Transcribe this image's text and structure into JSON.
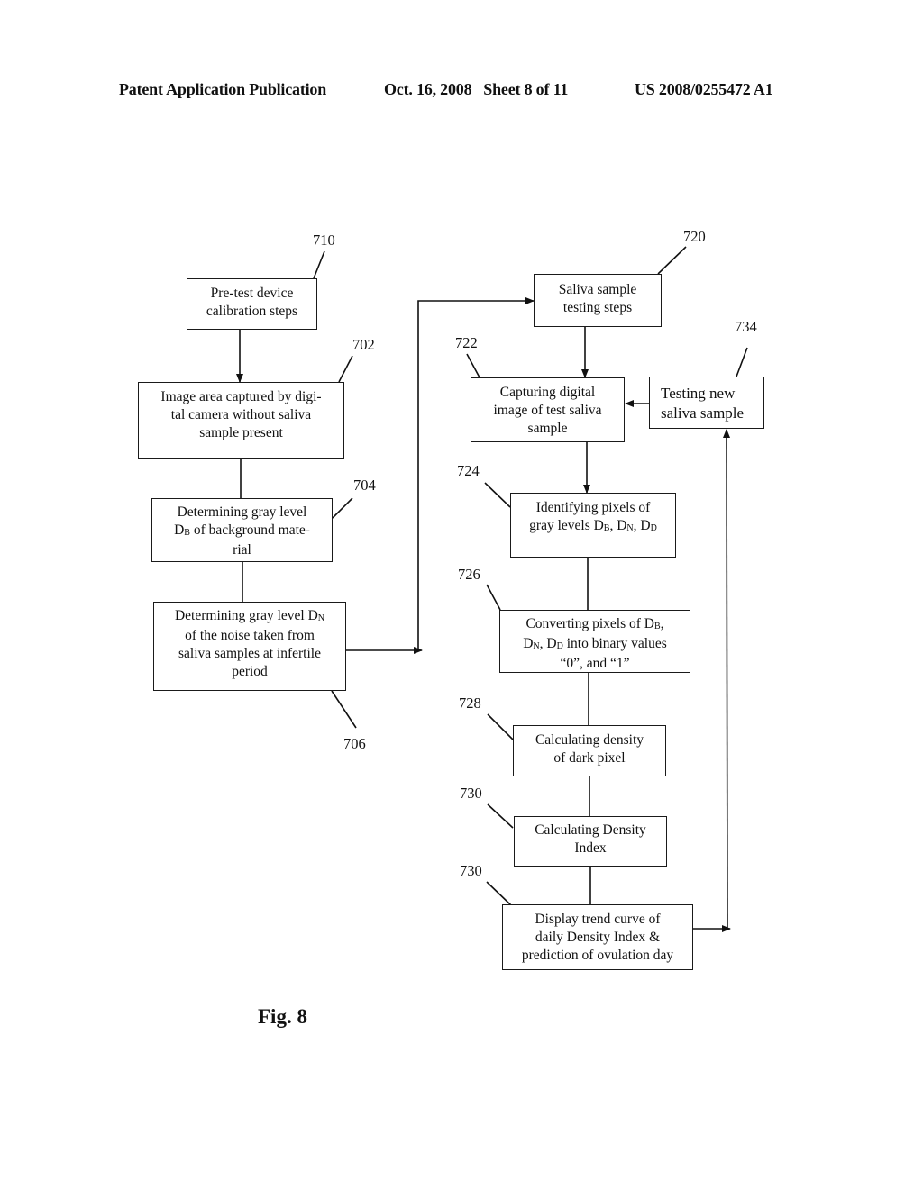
{
  "header": {
    "publication": "Patent Application Publication",
    "date_sheet": "Oct. 16, 2008   Sheet 8 of 11",
    "patent_number": "US 2008/0255472 A1"
  },
  "figure_label": "Fig. 8",
  "nodes": {
    "n710": {
      "ref": "710",
      "lines": [
        "Pre-test device",
        "calibration steps"
      ]
    },
    "n702": {
      "ref": "702",
      "lines": [
        "Image area captured by digi-",
        "tal camera without saliva",
        "sample present"
      ]
    },
    "n704": {
      "ref": "704",
      "line1": "Determining gray level",
      "line2_sym": "D",
      "line2_sub": "B",
      "line2_rest": " of background mate-",
      "line3": "rial"
    },
    "n706": {
      "ref": "706",
      "line1_pre": "Determining gray level D",
      "line1_sub": "N",
      "lines_rest": [
        "of the noise taken from",
        "saliva samples at infertile",
        "period"
      ]
    },
    "n720": {
      "ref": "720",
      "lines": [
        "Saliva sample",
        "testing steps"
      ]
    },
    "n722": {
      "ref": "722",
      "lines": [
        "Capturing digital",
        "image of test saliva",
        "sample"
      ]
    },
    "n734": {
      "ref": "734",
      "lines": [
        "Testing new",
        "saliva sample"
      ]
    },
    "n724": {
      "ref": "724",
      "line1": "Identifying pixels of",
      "line2_pre": "gray levels D",
      "sub_b": "B",
      "sub_n": "N",
      "sub_d": "D"
    },
    "n726": {
      "ref": "726",
      "line1_pre": "Converting pixels of D",
      "sub_b": "B",
      "sub_n": "N",
      "sub_d": "D",
      "line2_mid": " into binary values",
      "line3": "“0”, and “1”"
    },
    "n728": {
      "ref": "728",
      "lines": [
        "Calculating density",
        "of dark pixel"
      ]
    },
    "n730a": {
      "ref": "730",
      "lines": [
        "Calculating Density",
        "Index"
      ]
    },
    "n730b": {
      "ref": "730",
      "lines": [
        "Display trend curve of",
        "daily Density Index &",
        "prediction of ovulation day"
      ]
    }
  }
}
